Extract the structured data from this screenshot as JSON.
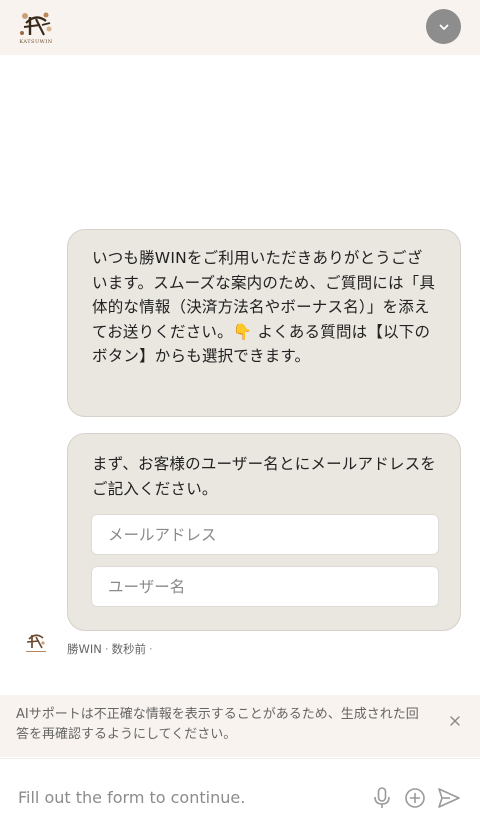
{
  "header": {
    "logo_text": "KATSUWIN",
    "logo_icon": "katsuwin-logo-icon",
    "collapse_icon": "chevron-down-icon"
  },
  "messages": [
    {
      "text": "いつも勝WINをご利用いただきありがとうございます。スムーズな案内のため、ご質問には「具体的な情報（決済方法名やボーナス名）」を添えてお送りください。👇 よくある質問は【以下のボタン】からも選択できます。"
    },
    {
      "text": "まず、お客様のユーザー名とにメールアドレスをご記入ください。"
    }
  ],
  "form": {
    "email_placeholder": "メールアドレス",
    "username_placeholder": "ユーザー名"
  },
  "meta": {
    "sender": "勝WIN",
    "time": "数秒前"
  },
  "disclaimer": {
    "text": "AIサポートは不正確な情報を表示することがあるため、生成された回答を再確認するようにしてください。",
    "close_icon": "close-icon"
  },
  "composer": {
    "placeholder": "Fill out the form to continue.",
    "mic_icon": "microphone-icon",
    "add_icon": "plus-circle-icon",
    "send_icon": "send-icon"
  },
  "colors": {
    "header_bg": "#f8f3ef",
    "bubble_bg": "#eae6e0",
    "collapse_bg": "#8d8d8d",
    "brand": "#6b4a2b"
  }
}
